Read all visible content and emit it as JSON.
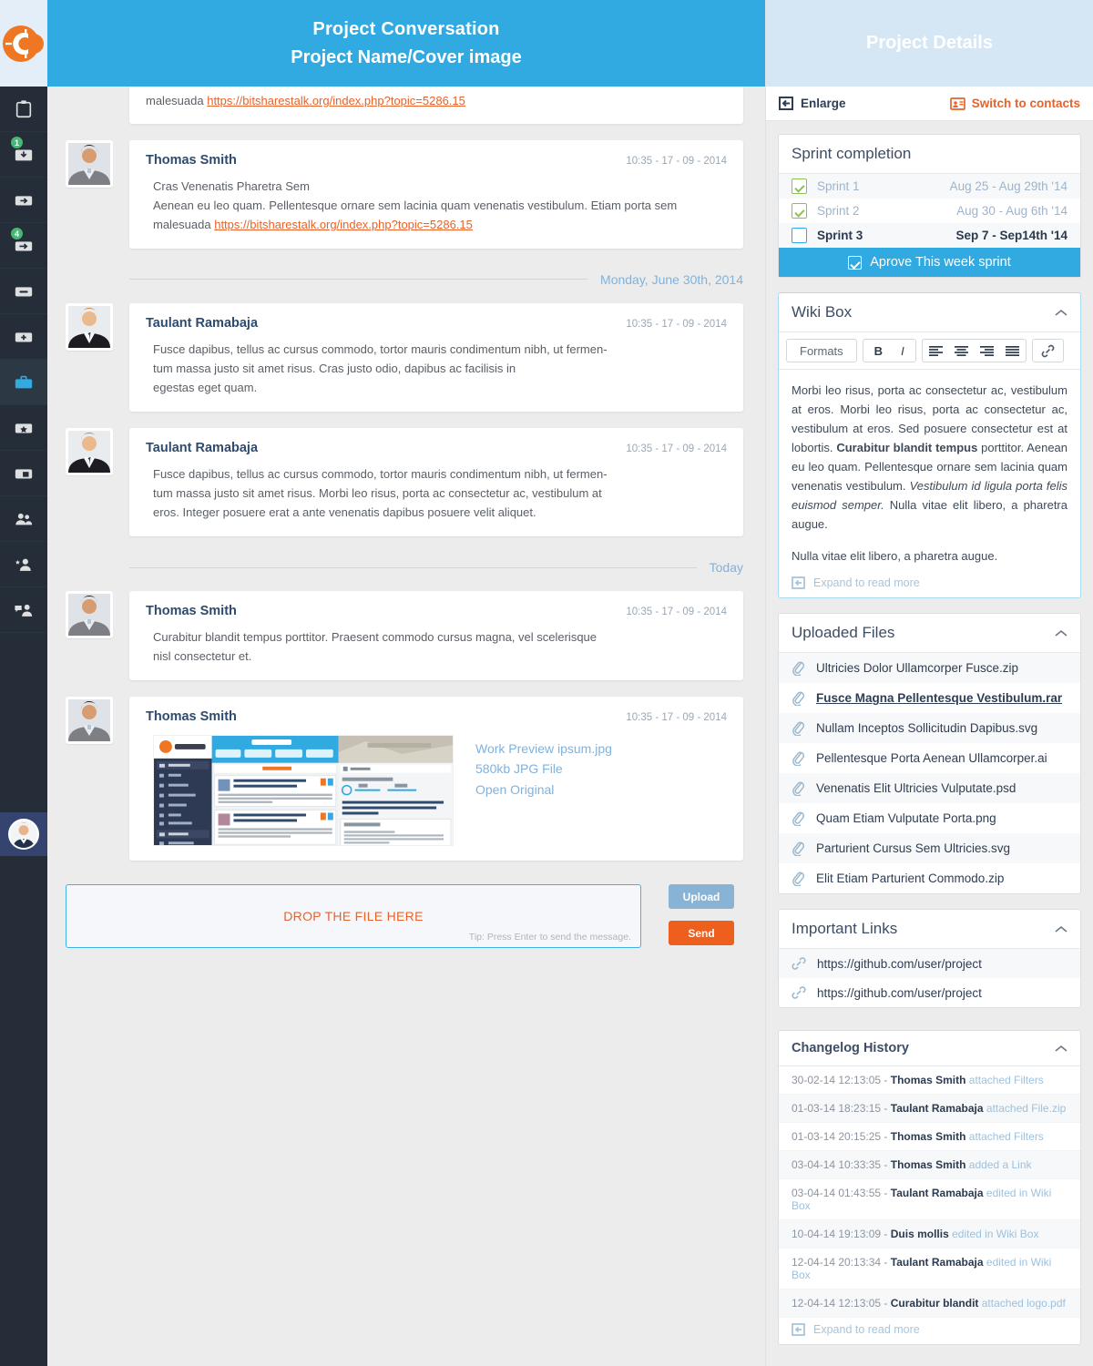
{
  "colors": {
    "accent_blue": "#31aae2",
    "accent_orange": "#e8622a",
    "rail_dark": "#242d38",
    "badge_green": "#49b675",
    "send_orange": "#ee5f1e",
    "upload_blue": "#88b3d4",
    "panel_head": "#d5e6f5"
  },
  "rail": {
    "logo_name": "coinality-logo",
    "items": [
      {
        "icon": "clipboard-icon",
        "badge": ""
      },
      {
        "icon": "inbox-download-icon",
        "badge": "1"
      },
      {
        "icon": "folder-arrow-right-icon",
        "badge": ""
      },
      {
        "icon": "folder-arrow-out-icon",
        "badge": "4"
      },
      {
        "icon": "archive-box-icon",
        "badge": ""
      },
      {
        "icon": "folder-plus-icon",
        "badge": ""
      },
      {
        "icon": "briefcase-icon",
        "badge": "",
        "active": true
      },
      {
        "icon": "folder-star-icon",
        "badge": ""
      },
      {
        "icon": "folder-card-icon",
        "badge": ""
      },
      {
        "icon": "users-icon",
        "badge": ""
      },
      {
        "icon": "user-add-icon",
        "badge": ""
      },
      {
        "icon": "user-chat-icon",
        "badge": ""
      }
    ],
    "avatar_name": "current-user-avatar"
  },
  "header": {
    "title": "Project Conversation",
    "subtitle": "Project Name/Cover image"
  },
  "conversation": {
    "clipped_message": {
      "text_before": "malesuada ",
      "link": "https://bitsharestalk.org/index.php?topic=5286.15"
    },
    "messages": [
      {
        "author": "Thomas Smith",
        "time": "10:35 - 17 - 09 - 2014",
        "avatar": "thomas-smith-avatar",
        "lines": [
          "Cras Venenatis Pharetra Sem",
          "Aenean eu leo quam. Pellentesque ornare sem lacinia quam venenatis vestibulum. Etiam porta sem"
        ],
        "tail_before": "malesuada ",
        "tail_link": "https://bitsharestalk.org/index.php?topic=5286.15"
      },
      {
        "author": "Taulant Ramabaja",
        "time": "10:35 - 17 - 09 - 2014",
        "avatar": "taulant-ramabaja-avatar",
        "lines": [
          "Fusce dapibus, tellus ac cursus commodo, tortor mauris condimentum nibh, ut fermen-",
          "tum massa justo sit amet risus. Cras justo odio, dapibus ac facilisis in",
          "egestas eget quam."
        ]
      },
      {
        "author": "Taulant Ramabaja",
        "time": "10:35 - 17 - 09 - 2014",
        "avatar": "taulant-ramabaja-avatar",
        "lines": [
          "Fusce dapibus, tellus ac cursus commodo, tortor mauris condimentum nibh, ut fermen-",
          "tum massa justo sit amet risus. Morbi leo risus, porta ac consectetur ac, vestibulum at",
          "eros. Integer posuere erat a ante venenatis dapibus posuere velit aliquet."
        ]
      },
      {
        "author": "Thomas Smith",
        "time": "10:35 - 17 - 09 - 2014",
        "avatar": "thomas-smith-avatar",
        "lines": [
          "Curabitur blandit tempus porttitor. Praesent commodo cursus magna, vel scelerisque",
          "nisl consectetur et."
        ]
      }
    ],
    "separators": {
      "first": "Monday, June 30th, 2014",
      "second": "Today"
    },
    "attachment_message": {
      "author": "Thomas Smith",
      "time": "10:35 - 17 - 09 - 2014",
      "avatar": "thomas-smith-avatar",
      "file_name": "Work Preview ipsum.jpg",
      "file_size": "580kb JPG File",
      "open_original": "Open Original",
      "thumb_name": "work-preview-thumbnail"
    },
    "composer": {
      "dropzone_label": "DROP THE FILE HERE",
      "tip": "Tip: Press Enter to send the message.",
      "placeholder": "DROP THE FILE HERE",
      "upload_label": "Upload",
      "send_label": "Send"
    }
  },
  "details": {
    "panel_title": "Project Details",
    "toolbar": {
      "enlarge_label": "Enlarge",
      "enlarge_icon": "enlarge-arrow-icon",
      "switch_label": "Switch to contacts",
      "switch_icon": "contact-card-icon"
    },
    "sprint": {
      "title": "Sprint completion",
      "rows": [
        {
          "label": "Sprint 1",
          "dates": "Aug 25 - Aug 29th '14",
          "done": true
        },
        {
          "label": "Sprint 2",
          "dates": "Aug 30 - Aug 6th '14",
          "done": true
        },
        {
          "label": "Sprint 3",
          "dates": "Sep 7 - Sep14th '14",
          "done": false
        }
      ],
      "approve_label": "Aprove This week sprint"
    },
    "wiki": {
      "title": "Wiki Box",
      "tools": {
        "formats": "Formats",
        "bold": "B",
        "italic": "I",
        "align_left": "align-left-icon",
        "align_center": "align-center-icon",
        "align_right": "align-right-icon",
        "align_justify": "align-justify-icon",
        "link": "link-icon"
      },
      "paragraph_1_a": "Morbi leo risus, porta ac consectetur ac, vestibulum at eros. Morbi leo risus, porta ac consectetur ac, vestibulum at eros. Sed posuere consectetur est at lobortis. ",
      "paragraph_1_bold": "Curabitur blandit tempus",
      "paragraph_1_b": " porttitor. Aenean eu leo quam. Pellentesque ornare sem lacinia quam venenatis vestibulum. ",
      "paragraph_1_italic": "Vestibulum id ligula porta felis euismod semper.",
      "paragraph_1_c": " Nulla vitae elit libero, a pharetra augue.",
      "paragraph_2": "Nulla vitae elit libero, a pharetra augue.",
      "expand_label": "Expand to read more"
    },
    "files": {
      "title": "Uploaded Files",
      "items": [
        {
          "name": "Ultricies Dolor Ullamcorper Fusce.zip",
          "highlight": false
        },
        {
          "name": "Fusce Magna Pellentesque Vestibulum.rar",
          "highlight": true
        },
        {
          "name": "Nullam Inceptos Sollicitudin Dapibus.svg",
          "highlight": false
        },
        {
          "name": "Pellentesque Porta Aenean Ullamcorper.ai",
          "highlight": false
        },
        {
          "name": "Venenatis Elit Ultricies Vulputate.psd",
          "highlight": false
        },
        {
          "name": "Quam Etiam Vulputate Porta.png",
          "highlight": false
        },
        {
          "name": "Parturient Cursus Sem Ultricies.svg",
          "highlight": false
        },
        {
          "name": "Elit Etiam Parturient Commodo.zip",
          "highlight": false
        }
      ]
    },
    "links": {
      "title": "Important Links",
      "items": [
        "https://github.com/user/project",
        "https://github.com/user/project"
      ]
    },
    "changelog": {
      "title": "Changelog History",
      "expand_label": "Expand to read more",
      "items": [
        {
          "ts": "30-02-14 12:13:05 - ",
          "who": "Thomas Smith",
          "what": " attached Filters"
        },
        {
          "ts": "01-03-14 18:23:15 - ",
          "who": "Taulant  Ramabaja",
          "what": " attached File.zip"
        },
        {
          "ts": "01-03-14 20:15:25 - ",
          "who": "Thomas Smith",
          "what": " attached Filters"
        },
        {
          "ts": "03-04-14 10:33:35 - ",
          "who": "Thomas Smith",
          "what": " added a Link"
        },
        {
          "ts": "03-04-14 01:43:55 - ",
          "who": "Taulant  Ramabaja",
          "what": " edited in Wiki Box"
        },
        {
          "ts": "10-04-14 19:13:09 - ",
          "who": "Duis mollis",
          "what": " edited in Wiki Box"
        },
        {
          "ts": "12-04-14 20:13:34 - ",
          "who": "Taulant  Ramabaja",
          "what": " edited in Wiki Box"
        },
        {
          "ts": "12-04-14 12:13:05 - ",
          "who": "Curabitur blandit",
          "what": " attached logo.pdf"
        }
      ]
    }
  }
}
